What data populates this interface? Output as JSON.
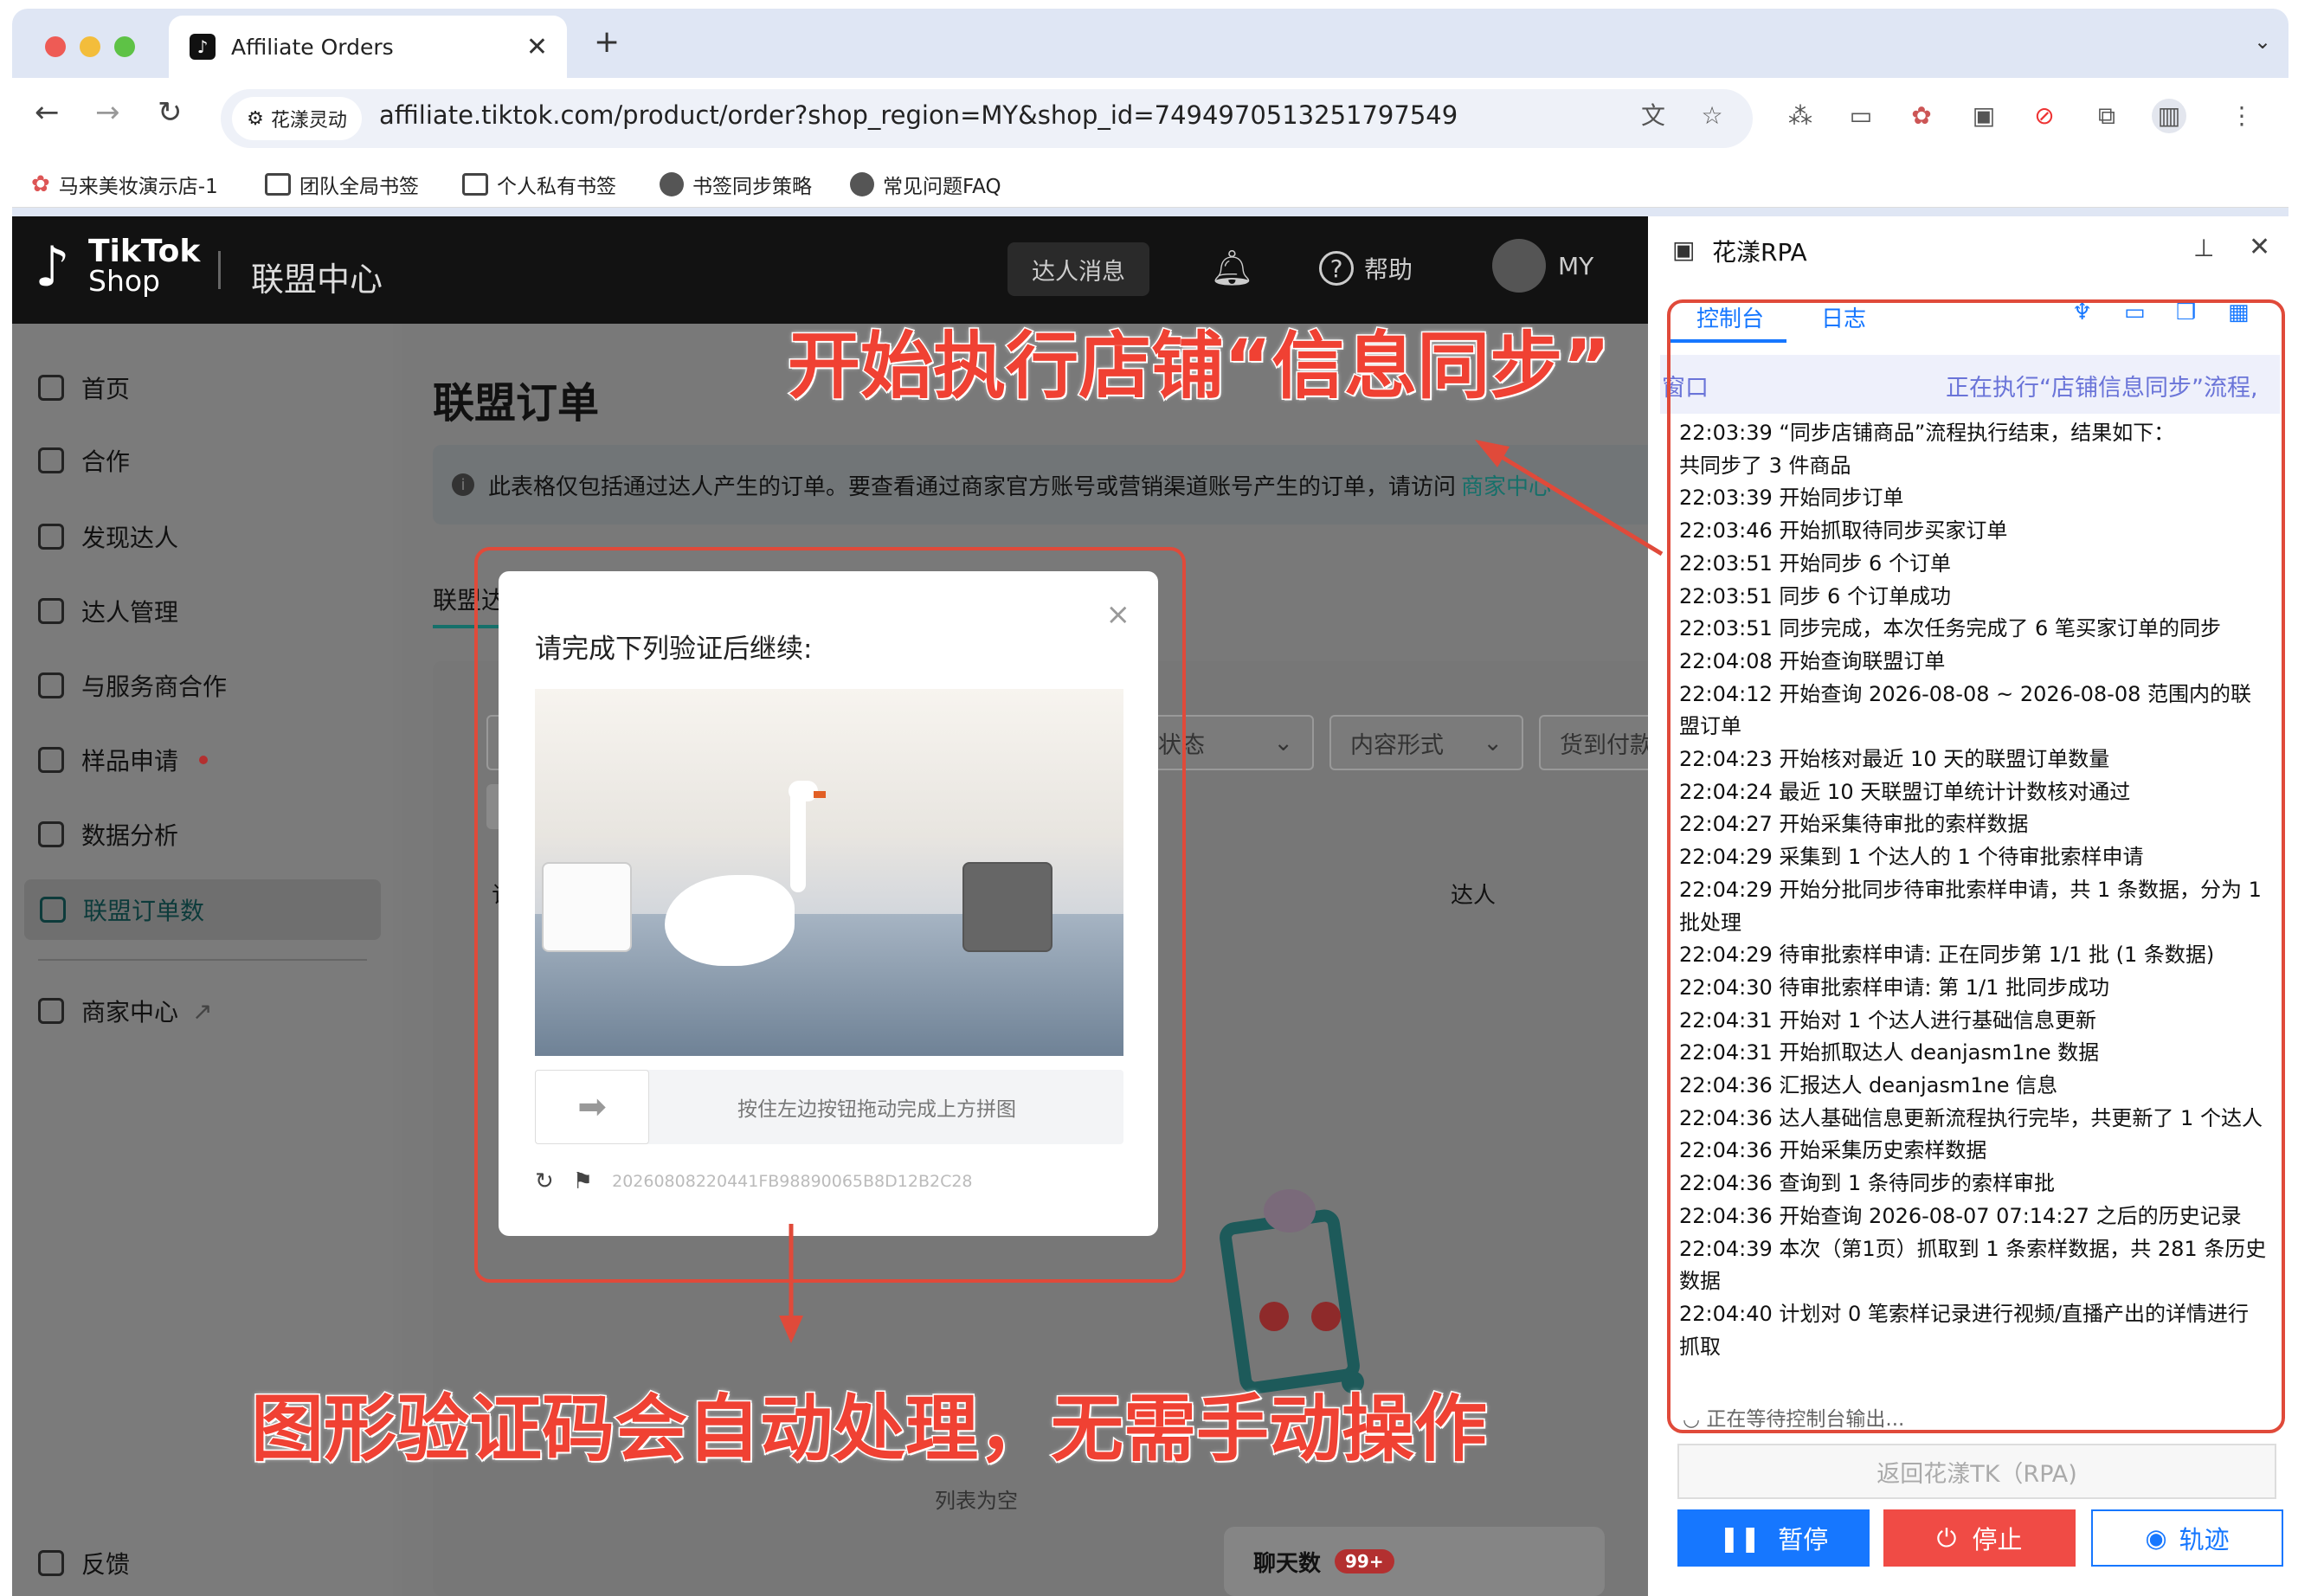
{
  "browser": {
    "tab_title": "Affiliate Orders",
    "site_chip": "花漾灵动",
    "url": "affiliate.tiktok.com/product/order?shop_region=MY&shop_id=7494970513251797549",
    "bookmarks": [
      "马来美妆演示店-1",
      "团队全局书签",
      "个人私有书签",
      "书签同步策略",
      "常见问题FAQ"
    ]
  },
  "header": {
    "logo_top": "TikTok",
    "logo_bottom": "Shop",
    "title": "联盟中心",
    "messages": "达人消息",
    "help": "帮助",
    "avatar": "MY"
  },
  "sidebar": {
    "items": [
      "首页",
      "合作",
      "发现达人",
      "达人管理",
      "与服务商合作",
      "样品申请",
      "数据分析",
      "联盟订单数",
      "商家中心"
    ],
    "feedback": "反馈"
  },
  "main": {
    "page_title": "联盟订单",
    "notice": "此表格仅包括通过达人产生的订单。要查看通过商家官方账号或营销渠道账号产生的订单，请访问",
    "notice_link": "商家中心",
    "tab": "联盟达人",
    "filters": [
      "订",
      "订单状态",
      "内容形式",
      "货到付款"
    ],
    "col_order": "订",
    "col_creator": "达人",
    "empty": "列表为空",
    "chat_label": "聊天数",
    "chat_badge": "99+"
  },
  "captcha": {
    "title": "请完成下列验证后继续:",
    "hint": "按住左边按钮拖动完成上方拼图",
    "id": "20260808220441FB98890065B8D12B2C28"
  },
  "rpa": {
    "title": "花漾RPA",
    "tabs": [
      "控制台",
      "日志"
    ],
    "banner_left": "窗口",
    "banner_right": "正在执行“店铺信息同步”流程,",
    "log": [
      "22:03:39 “同步店铺商品”流程执行结束，结果如下：",
      "共同步了 3 件商品",
      "22:03:39 开始同步订单",
      "22:03:46 开始抓取待同步买家订单",
      "22:03:51 开始同步 6 个订单",
      "22:03:51 同步 6 个订单成功",
      "22:03:51 同步完成，本次任务完成了 6 笔买家订单的同步",
      "22:04:08 开始查询联盟订单",
      "22:04:12 开始查询 2026-08-08 ~ 2026-08-08 范围内的联盟订单",
      "22:04:23 开始核对最近 10 天的联盟订单数量",
      "22:04:24 最近 10 天联盟订单统计计数核对通过",
      "22:04:27 开始采集待审批的索样数据",
      "22:04:29 采集到 1 个达人的 1 个待审批索样申请",
      "22:04:29 开始分批同步待审批索样申请，共 1 条数据，分为 1 批处理",
      "22:04:29 待审批索样申请: 正在同步第 1/1 批 (1 条数据)",
      "22:04:30 待审批索样申请: 第 1/1 批同步成功",
      "22:04:31 开始对 1 个达人进行基础信息更新",
      "22:04:31 开始抓取达人 deanjasm1ne 数据",
      "22:04:36 汇报达人 deanjasm1ne 信息",
      "22:04:36 达人基础信息更新流程执行完毕，共更新了 1 个达人",
      "22:04:36 开始采集历史索样数据",
      "22:04:36 查询到 1 条待同步的索样审批",
      "22:04:36 开始查询 2026-08-07 07:14:27 之后的历史记录",
      "22:04:39 本次（第1页）抓取到 1 条索样数据，共 281 条历史数据",
      "22:04:40 计划对 0 笔索样记录进行视频/直播产出的详情进行抓取"
    ],
    "waiting": "正在等待控制台输出...",
    "return_btn": "返回花漾TK（RPA)",
    "pause": "暂停",
    "stop": "停止",
    "track": "轨迹"
  },
  "annotations": {
    "top": "开始执行店铺“信息同步”",
    "bottom": "图形验证码会自动处理，无需手动操作"
  },
  "colors": {
    "accent": "#1677ff",
    "annotation": "#f04133",
    "tiktok_teal": "#16706a"
  }
}
